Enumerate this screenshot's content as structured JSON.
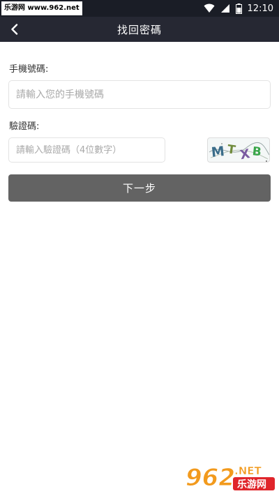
{
  "status_bar": {
    "watermark": "乐游网 www.962.net",
    "time": "12:10"
  },
  "header": {
    "title": "找回密碼"
  },
  "form": {
    "phone_label": "手機號碼:",
    "phone_placeholder": "請輸入您的手機號碼",
    "code_label": "驗證碼:",
    "code_placeholder": "請輸入驗證碼（4位數字）",
    "captcha_text": "MTXB",
    "next_label": "下一步"
  },
  "logo": {
    "brand": "962.NET",
    "name": "乐游网"
  },
  "colors": {
    "navbar": "#262833",
    "statusbar": "#1a1d26",
    "button": "#636363",
    "logo_orange": "#f29a1d",
    "logo_red": "#e0252b"
  }
}
